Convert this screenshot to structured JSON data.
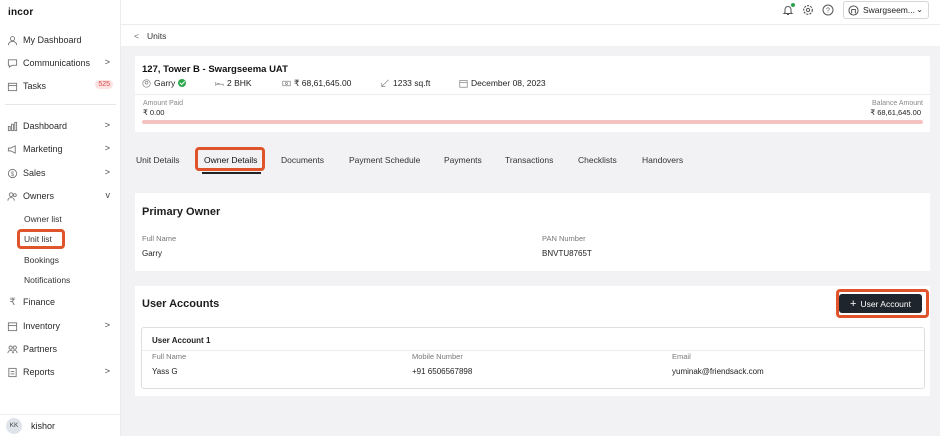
{
  "app": {
    "logo": "incor"
  },
  "sidebar": {
    "items": [
      {
        "label": "My Dashboard",
        "icon": "user-icon"
      },
      {
        "label": "Communications",
        "icon": "chat-icon",
        "chevron": ">"
      },
      {
        "label": "Tasks",
        "icon": "calendar-icon",
        "badge": "525"
      },
      {
        "label": "Dashboard",
        "icon": "chart-icon",
        "chevron": ">"
      },
      {
        "label": "Marketing",
        "icon": "megaphone-icon",
        "chevron": ">"
      },
      {
        "label": "Sales",
        "icon": "dollar-icon",
        "chevron": ">"
      },
      {
        "label": "Owners",
        "icon": "users-icon",
        "chevron": "v"
      },
      {
        "label": "Finance",
        "icon": "rupee-icon"
      },
      {
        "label": "Inventory",
        "icon": "box-icon",
        "chevron": ">"
      },
      {
        "label": "Partners",
        "icon": "partners-icon"
      },
      {
        "label": "Reports",
        "icon": "report-icon",
        "chevron": ">"
      }
    ],
    "owners_sub": [
      "Owner list",
      "Unit list",
      "Bookings",
      "Notifications"
    ],
    "user": {
      "initials": "KK",
      "name": "kishor"
    }
  },
  "topbar": {
    "project": "Swargseem..."
  },
  "breadcrumb": {
    "back": "<",
    "label": "Units"
  },
  "unit": {
    "title": "127, Tower B - Swargseema UAT",
    "owner": "Garry",
    "config": "2 BHK",
    "price": "₹ 68,61,645.00",
    "area": "1233 sq.ft",
    "date": "December 08, 2023",
    "amount_paid_label": "Amount Paid",
    "amount_paid": "₹ 0.00",
    "balance_label": "Balance Amount",
    "balance": "₹ 68,61,645.00",
    "paid_fraction": 0
  },
  "tabs": [
    "Unit Details",
    "Owner Details",
    "Documents",
    "Payment Schedule",
    "Payments",
    "Transactions",
    "Checklists",
    "Handovers"
  ],
  "primary_owner": {
    "title": "Primary Owner",
    "full_name_label": "Full Name",
    "full_name": "Garry",
    "pan_label": "PAN Number",
    "pan": "BNVTU8765T"
  },
  "user_accounts": {
    "title": "User Accounts",
    "add_button": "User Account",
    "account": {
      "title": "User Account 1",
      "full_name_label": "Full Name",
      "full_name": "Yass G",
      "mobile_label": "Mobile Number",
      "mobile": "+91 6506567898",
      "email_label": "Email",
      "email": "yuminak@friendsack.com"
    }
  },
  "colors": {
    "highlight": "#e0542c",
    "button": "#1e252c",
    "progress": "#f6c3c3",
    "badge": "#d94a4a"
  }
}
